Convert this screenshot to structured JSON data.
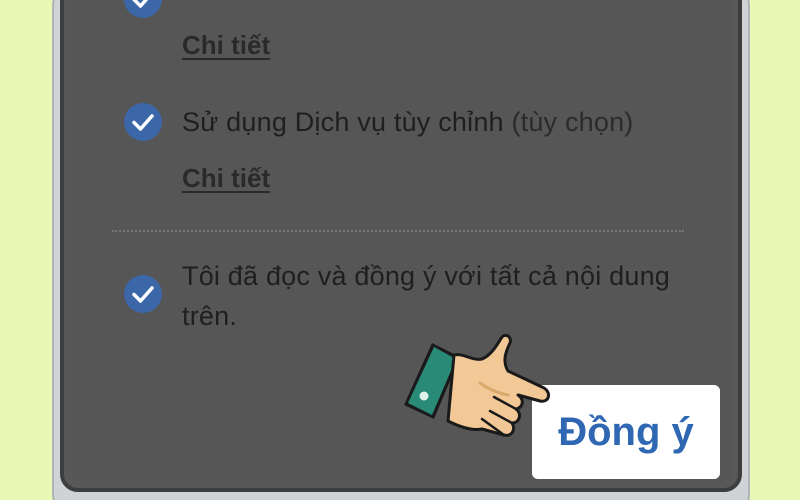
{
  "consent": {
    "items": [
      {
        "label": "",
        "detail_label": "Chi tiết",
        "checked": true
      },
      {
        "label": "Sử dụng Dịch vụ tùy chỉnh",
        "optional_suffix": "(tùy chọn)",
        "detail_label": "Chi tiết",
        "checked": true
      }
    ],
    "agree_all": {
      "line1": "Tôi đã đọc và đồng ý với tất cả nội dung",
      "line2": "trên.",
      "checked": true
    }
  },
  "actions": {
    "agree_label": "Đồng ý"
  },
  "icons": {
    "check": "check-icon",
    "pointer": "pointing-hand-icon"
  },
  "colors": {
    "page_background": "#e9f8b4",
    "dim_overlay": "#565656",
    "check_fill": "#3b67a8",
    "button_text": "#2f67b3",
    "button_bg": "#ffffff"
  }
}
